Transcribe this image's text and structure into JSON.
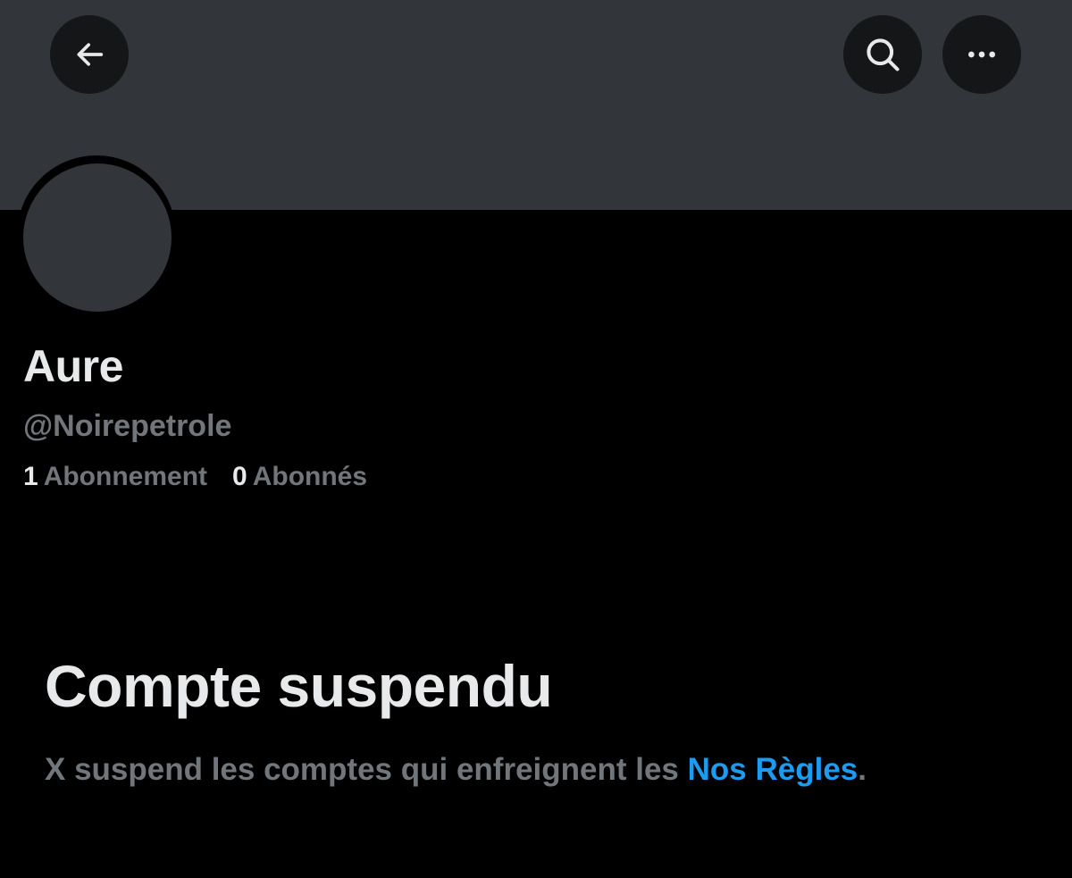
{
  "header": {
    "back_icon": "arrow-left-icon",
    "search_icon": "search-icon",
    "more_icon": "more-horizontal-icon"
  },
  "profile": {
    "display_name": "Aure",
    "handle": "@Noirepetrole",
    "following_count": "1",
    "following_label": "Abonnement",
    "followers_count": "0",
    "followers_label": "Abonnés"
  },
  "suspension": {
    "title": "Compte suspendu",
    "message_prefix": "X suspend les comptes qui enfreignent les ",
    "rules_link": "Nos Règles",
    "message_suffix": "."
  },
  "colors": {
    "background": "#000000",
    "banner": "#32353a",
    "primary_text": "#e7e9ea",
    "secondary_text": "#71767b",
    "link": "#1d9bf0"
  }
}
